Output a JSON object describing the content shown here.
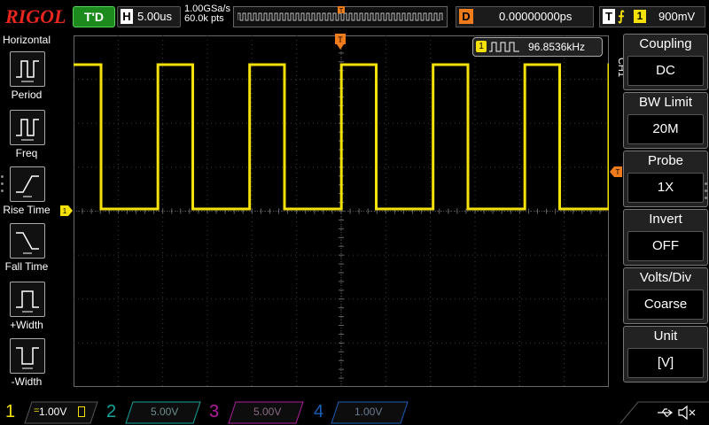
{
  "brand": "RIGOL",
  "status": "T'D",
  "horizontal": {
    "key": "H",
    "timebase": "5.00us",
    "sample_rate": "1.00GSa/s",
    "points": "60.0k pts"
  },
  "delay": {
    "key": "D",
    "value": "0.00000000ps"
  },
  "trigger": {
    "key": "T",
    "channel": "1",
    "level": "900mV",
    "edge": "rising-edge-icon"
  },
  "left_menu": {
    "title": "Horizontal",
    "items": [
      {
        "label": "Period",
        "icon": "period-icon"
      },
      {
        "label": "Freq",
        "icon": "frequency-icon"
      },
      {
        "label": "Rise Time",
        "icon": "rise-time-icon"
      },
      {
        "label": "Fall Time",
        "icon": "fall-time-icon"
      },
      {
        "label": "+Width",
        "icon": "positive-width-icon"
      },
      {
        "label": "-Width",
        "icon": "negative-width-icon"
      }
    ]
  },
  "measurement": {
    "channel": "1",
    "value": "96.8536kHz",
    "icon": "square-wave-icon"
  },
  "right_menu": {
    "channel_tab": "CH1",
    "items": [
      {
        "title": "Coupling",
        "value": "DC"
      },
      {
        "title": "BW Limit",
        "value": "20M"
      },
      {
        "title": "Probe",
        "value": "1X"
      },
      {
        "title": "Invert",
        "value": "OFF"
      },
      {
        "title": "Volts/Div",
        "value": "Coarse"
      },
      {
        "title": "Unit",
        "value": "[V]"
      }
    ]
  },
  "channels": [
    {
      "num": "1",
      "scale": "1.00V",
      "color": "#f5e10a",
      "active": true
    },
    {
      "num": "2",
      "scale": "5.00V",
      "color": "#15a39b",
      "active": false
    },
    {
      "num": "3",
      "scale": "5.00V",
      "color": "#b01f9e",
      "active": false
    },
    {
      "num": "4",
      "scale": "1.00V",
      "color": "#1b5fb8",
      "active": false
    }
  ],
  "colors": {
    "ch1": "#f5e10a",
    "orange": "#f07b1a",
    "grid": "#3d3d3d"
  },
  "icons": {
    "usb": "usb-icon",
    "speaker": "speaker-muted-icon"
  },
  "waveform": {
    "type": "square",
    "frequency": "96.8536kHz",
    "cycles_on_screen": 6
  }
}
